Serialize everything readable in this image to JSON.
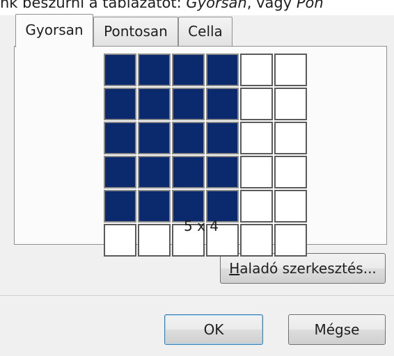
{
  "intro_text": {
    "prefix": "nk beszúrni a táblázatot: ",
    "em1": "Gyorsan",
    "middle": ", vagy ",
    "em2": "Pon"
  },
  "tabs": [
    {
      "label": "Gyorsan",
      "active": true
    },
    {
      "label": "Pontosan",
      "active": false
    },
    {
      "label": "Cella",
      "active": false
    }
  ],
  "table_picker": {
    "grid_columns": 6,
    "grid_rows": 6,
    "selected_columns": 4,
    "selected_rows": 5,
    "size_label": "5 x 4",
    "selected_color": "#0b2a6e"
  },
  "buttons": {
    "advanced": "Haladó szerkesztés...",
    "ok": "OK",
    "cancel": "Mégse"
  }
}
